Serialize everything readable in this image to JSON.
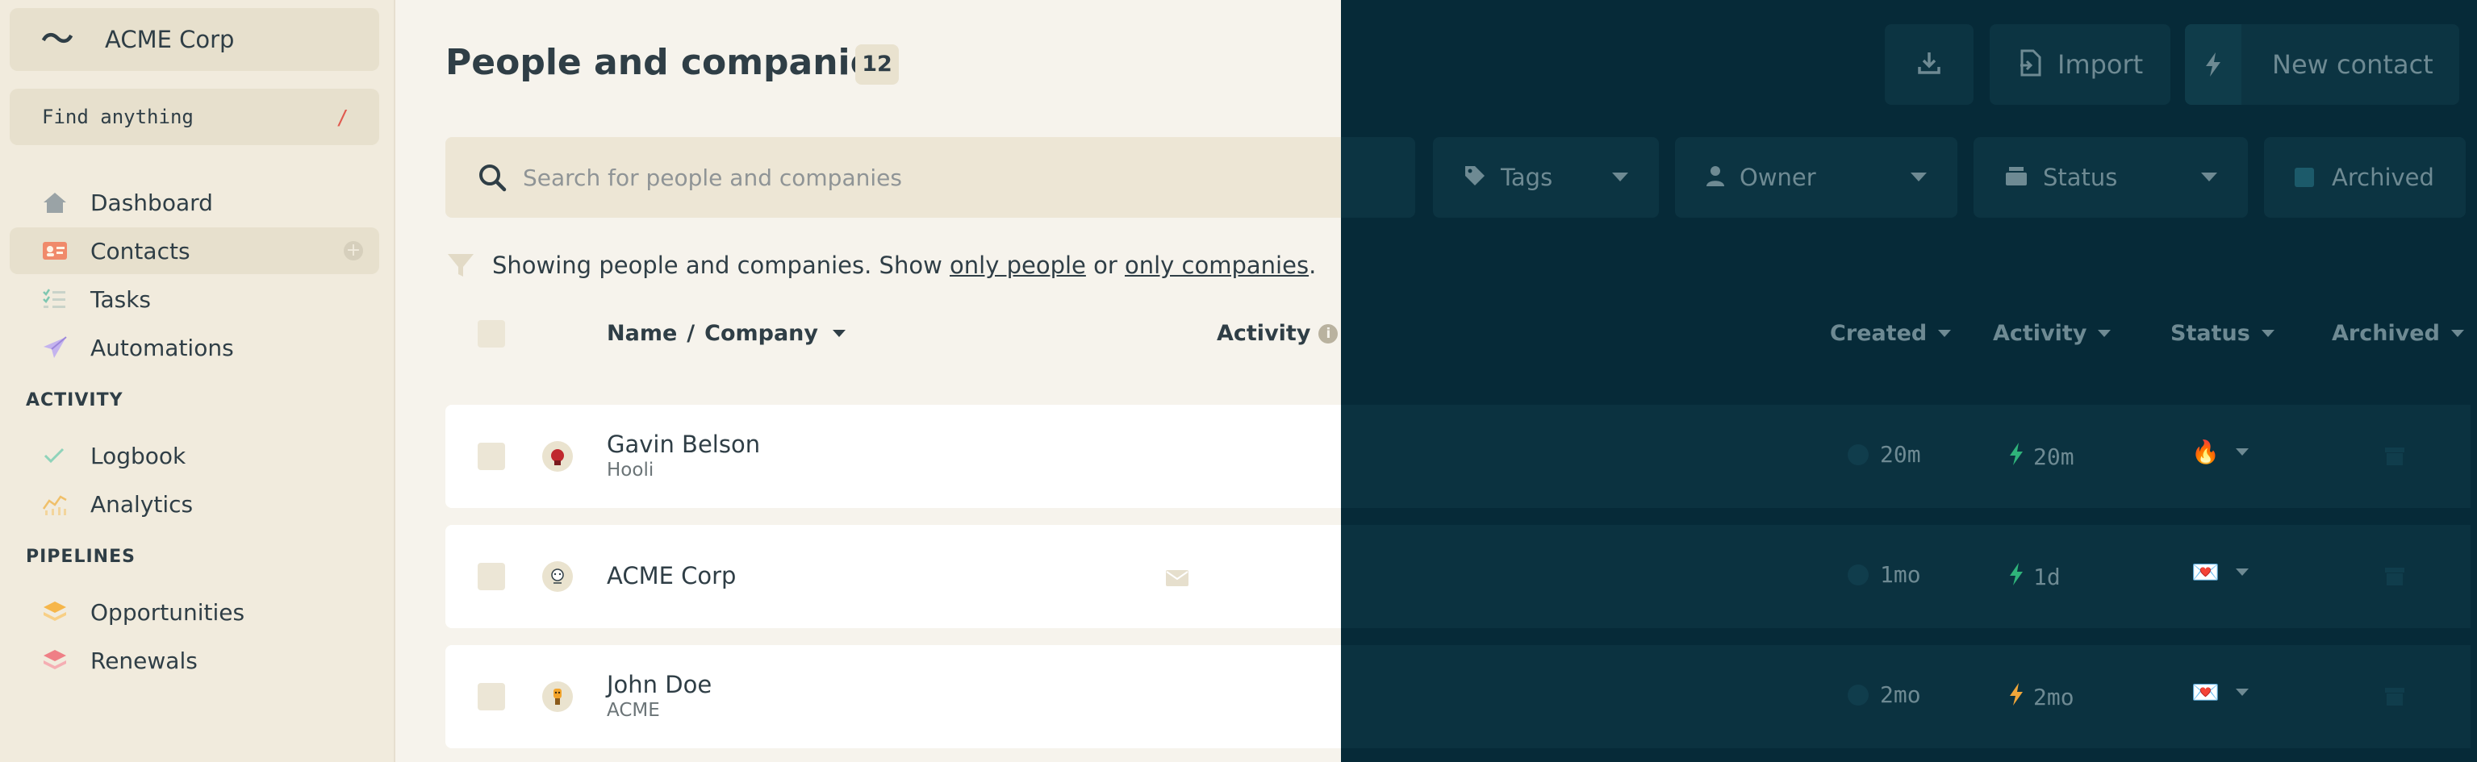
{
  "sidebar": {
    "org_name": "ACME Corp",
    "find_label": "Find anything",
    "find_shortcut": "/",
    "items": [
      {
        "label": "Dashboard",
        "icon": "house-icon"
      },
      {
        "label": "Contacts",
        "icon": "contact-card-icon"
      },
      {
        "label": "Tasks",
        "icon": "checklist-icon"
      },
      {
        "label": "Automations",
        "icon": "paper-plane-icon"
      }
    ],
    "sections": [
      {
        "title": "ACTIVITY",
        "items": [
          {
            "label": "Logbook",
            "icon": "check-icon"
          },
          {
            "label": "Analytics",
            "icon": "chart-icon"
          }
        ]
      },
      {
        "title": "PIPELINES",
        "items": [
          {
            "label": "Opportunities",
            "icon": "stack-icon"
          },
          {
            "label": "Renewals",
            "icon": "stack-icon"
          }
        ]
      }
    ]
  },
  "header": {
    "title": "People and companies",
    "count": "12",
    "download_icon": "download-icon",
    "import_label": "Import",
    "new_contact_label": "New contact"
  },
  "search": {
    "placeholder": "Search for people and companies"
  },
  "filters": {
    "tags": "Tags",
    "owner": "Owner",
    "status": "Status",
    "archived": "Archived"
  },
  "filter_text": {
    "prefix": "Showing people and companies. Show ",
    "link_people": "only people",
    "middle": " or ",
    "link_companies": "only companies",
    "suffix": "."
  },
  "columns": {
    "name": "Name",
    "sep": "/",
    "company": "Company",
    "activity_left": "Activity",
    "created": "Created",
    "activity": "Activity",
    "status": "Status",
    "archived": "Archived"
  },
  "rows": [
    {
      "name": "Gavin Belson",
      "company": "Hooli",
      "created": "20m",
      "activity": "20m",
      "status_emoji": "🔥",
      "activity_color": "#2fb37a"
    },
    {
      "name": "ACME Corp",
      "company": "",
      "created": "1mo",
      "activity": "1d",
      "status_emoji": "💌",
      "activity_color": "#2fb37a"
    },
    {
      "name": "John Doe",
      "company": "ACME",
      "created": "2mo",
      "activity": "2mo",
      "status_emoji": "💌",
      "activity_color": "#f0a63a"
    }
  ],
  "colors": {
    "sidebar_bg": "#f1ebdd",
    "main_bg": "#f6f3ec",
    "overlay_bg": "#062a38",
    "accent_slash": "#e05a4f"
  }
}
